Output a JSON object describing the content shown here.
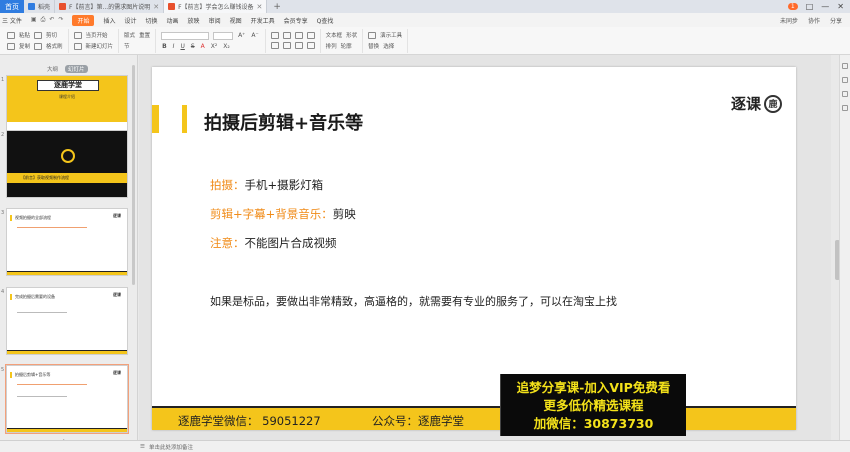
{
  "tabs": [
    {
      "label": "稻壳",
      "active": false,
      "color": "#2f7ce0"
    },
    {
      "label": "F【前言】第...的需求图片说明",
      "active": false,
      "color": "#e8502d"
    },
    {
      "label": "F【前言】学会怎么赚钱设备",
      "active": true,
      "color": "#e8502d"
    }
  ],
  "home_label": "首页",
  "window_controls": {
    "badge": "1",
    "labels": [
      "□",
      "—",
      "✕"
    ]
  },
  "menu": {
    "file": "三 文件",
    "items": [
      "开始",
      "插入",
      "设计",
      "切换",
      "动画",
      "放映",
      "审阅",
      "视图",
      "开发工具",
      "会员专享",
      "Q查找"
    ],
    "right": [
      "未同步",
      "协作",
      "分享"
    ]
  },
  "ribbon": {
    "groups": [
      {
        "row1": [
          "粘贴",
          "剪切"
        ],
        "row2": [
          "复制",
          "格式刷"
        ]
      },
      {
        "row1": [
          "当页开始"
        ],
        "row2": [
          "新建幻灯片"
        ]
      },
      {
        "row1": [
          "版式",
          "重置"
        ],
        "row2": [
          "节"
        ]
      },
      {
        "row1": [
          "B",
          "I",
          "U",
          "S"
        ],
        "row2": [
          "A",
          "X²",
          "X₂"
        ]
      },
      {
        "row1": [
          "文本框",
          "形状"
        ],
        "row2": [
          "排列",
          "轮廓"
        ]
      },
      {
        "row1": [
          "演示工具"
        ],
        "row2": [
          "替换",
          "选择"
        ]
      }
    ]
  },
  "panel": {
    "tabs": [
      "大纲",
      "幻灯片"
    ]
  },
  "thumbnails": [
    {
      "num": "1",
      "title": "逐鹿学堂",
      "sub": "课程介绍"
    },
    {
      "num": "2",
      "band": "【前言】获取视频制作流程"
    },
    {
      "num": "3",
      "heading": "视频拍摄的全部流程"
    },
    {
      "num": "4",
      "heading": "完成拍摄后需要的设备"
    },
    {
      "num": "5",
      "heading": "拍摄后剪辑+音乐等"
    }
  ],
  "slide": {
    "title": "拍摄后剪辑+音乐等",
    "brand": "逐课",
    "seal": "鹿",
    "lines": [
      {
        "key": "拍摄：",
        "value": "手机+摄影灯箱"
      },
      {
        "key": "剪辑+字幕+背景音乐：",
        "value": "剪映"
      },
      {
        "key": "注意：",
        "value": "不能图片合成视频"
      }
    ],
    "note": "如果是标品，要做出非常精致，高逼格的，就需要有专业的服务了，可以在淘宝上找",
    "footer_wechat": "逐鹿学堂微信：  59051227",
    "footer_public": "公众号：逐鹿学堂"
  },
  "promo": {
    "line1": "追梦分享课-加入VIP免费看",
    "line2": "更多低价精选课程",
    "line3": "加微信：30873730"
  },
  "status": {
    "hint": "单击此处添加备注"
  }
}
